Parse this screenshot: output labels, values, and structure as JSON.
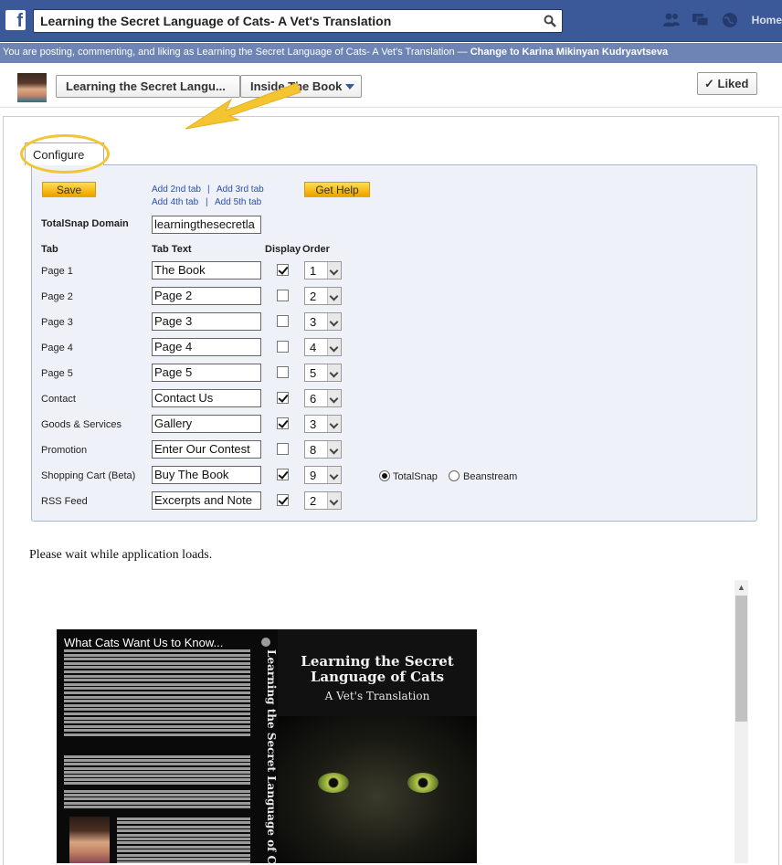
{
  "topbar": {
    "search_value": "Learning the Secret Language of Cats- A Vet's Translation",
    "home_label": "Home"
  },
  "posting_bar": {
    "text": "You are posting, commenting, and liking as Learning the Secret Language of Cats- A Vet's Translation — ",
    "change_link": "Change to Karina Mikinyan Kudryavtseva"
  },
  "page_header": {
    "page_name_button": "Learning the Secret Langu...",
    "tab_button": "Inside The Book",
    "liked_button": "✓ Liked"
  },
  "config": {
    "tab_label": "Configure",
    "save_label": "Save",
    "help_label": "Get Help",
    "add_links": [
      "Add 2nd tab",
      "Add 3rd tab",
      "Add 4th tab",
      "Add 5th tab"
    ],
    "link_sep": "|",
    "domain_label": "TotalSnap Domain",
    "domain_value": "learningthesecretla",
    "headers": {
      "tab": "Tab",
      "text": "Tab Text",
      "display": "Display",
      "order": "Order"
    },
    "rows": [
      {
        "tab": "Page 1",
        "text": "The Book",
        "display": true,
        "order": "1"
      },
      {
        "tab": "Page 2",
        "text": "Page 2",
        "display": false,
        "order": "2"
      },
      {
        "tab": "Page 3",
        "text": "Page 3",
        "display": false,
        "order": "3"
      },
      {
        "tab": "Page 4",
        "text": "Page 4",
        "display": false,
        "order": "4"
      },
      {
        "tab": "Page 5",
        "text": "Page 5",
        "display": false,
        "order": "5"
      },
      {
        "tab": "Contact",
        "text": "Contact Us",
        "display": true,
        "order": "6"
      },
      {
        "tab": "Goods & Services",
        "text": "Gallery",
        "display": true,
        "order": "3"
      },
      {
        "tab": "Promotion",
        "text": "Enter Our Contest",
        "display": false,
        "order": "8"
      },
      {
        "tab": "Shopping Cart (Beta)",
        "text": "Buy The Book",
        "display": true,
        "order": "9"
      },
      {
        "tab": "RSS Feed",
        "text": "Excerpts and Note",
        "display": true,
        "order": "2"
      }
    ],
    "cart_options": [
      {
        "label": "TotalSnap",
        "selected": true
      },
      {
        "label": "Beanstream",
        "selected": false
      }
    ]
  },
  "content": {
    "wait_text": "Please wait while application loads.",
    "book": {
      "back_title": "What Cats Want Us to Know...",
      "spine_title": "Learning the Secret Language of Cats",
      "front_title": "Learning the Secret Language of Cats",
      "front_subtitle": "A Vet's Translation"
    }
  },
  "colors": {
    "facebook_blue": "#3b5998",
    "posting_bar": "#6d84b4",
    "highlight_yellow": "#f5c431",
    "button_yellow": "#f2a900",
    "panel_bg": "#eef2f8"
  }
}
